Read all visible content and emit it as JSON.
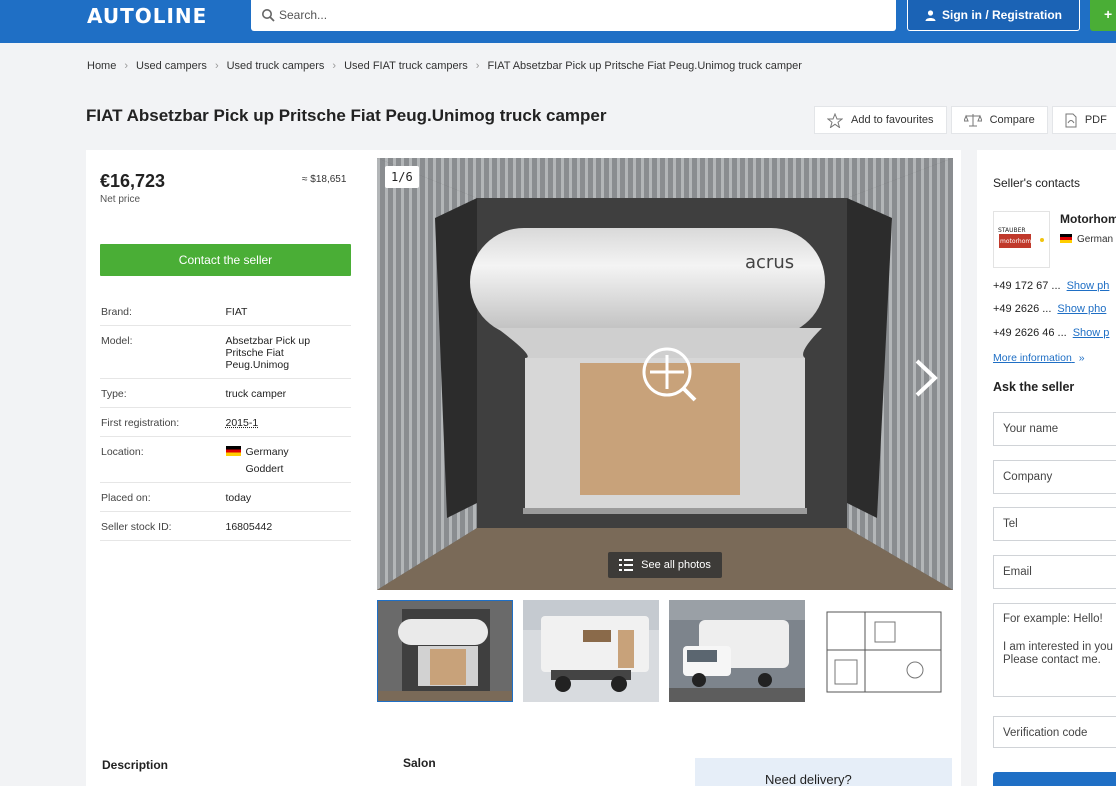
{
  "header": {
    "logo": "AUTOLINE",
    "search_placeholder": "Search...",
    "signin_label": "Sign in / Registration",
    "add_label": "+"
  },
  "breadcrumb": [
    "Home",
    "Used campers",
    "Used truck campers",
    "Used FIAT truck campers",
    "FIAT Absetzbar Pick up Pritsche Fiat Peug.Unimog truck camper"
  ],
  "title": "FIAT Absetzbar Pick up Pritsche Fiat Peug.Unimog truck camper",
  "actions": {
    "favourites": "Add to favourites",
    "compare": "Compare",
    "pdf": "PDF"
  },
  "listing": {
    "price": "€16,723",
    "price_note": "Net price",
    "usd": "≈ $18,651",
    "contact_label": "Contact the seller",
    "specs": [
      {
        "key": "Brand:",
        "value": "FIAT"
      },
      {
        "key": "Model:",
        "value": "Absetzbar Pick up Pritsche Fiat Peug.Unimog"
      },
      {
        "key": "Type:",
        "value": "truck camper"
      },
      {
        "key": "First registration:",
        "value": "2015-1"
      },
      {
        "key": "Location:",
        "value": "Germany",
        "value2": "Goddert"
      },
      {
        "key": "Placed on:",
        "value": "today"
      },
      {
        "key": "Seller stock ID:",
        "value": "16805442"
      }
    ]
  },
  "gallery": {
    "counter": "1/6",
    "see_all": "See all photos",
    "main_logo": "acrus"
  },
  "sections": {
    "description": "Description",
    "salon": "Salon",
    "delivery": "Need delivery?"
  },
  "seller": {
    "contacts_title": "Seller's contacts",
    "name": "Motorhom",
    "country": "German",
    "logo_text": "STAUBER motorhomes",
    "phones": [
      {
        "number": "+49 172 67 ...",
        "show": "Show ph"
      },
      {
        "number": "+49 2626 ...",
        "show": "Show pho"
      },
      {
        "number": "+49 2626 46 ...",
        "show": "Show p"
      }
    ],
    "more_info": "More information",
    "ask_title": "Ask the seller",
    "form": {
      "name": "Your name",
      "company": "Company",
      "tel": "Tel",
      "email": "Email",
      "message_line1": "For example: Hello!",
      "message_line2": "I am interested in you",
      "message_line3": "Please contact me.",
      "verification": "Verification code"
    }
  },
  "colors": {
    "header_blue": "#1f6fc5",
    "green": "#4aae36",
    "link_blue": "#1f6fc5"
  }
}
